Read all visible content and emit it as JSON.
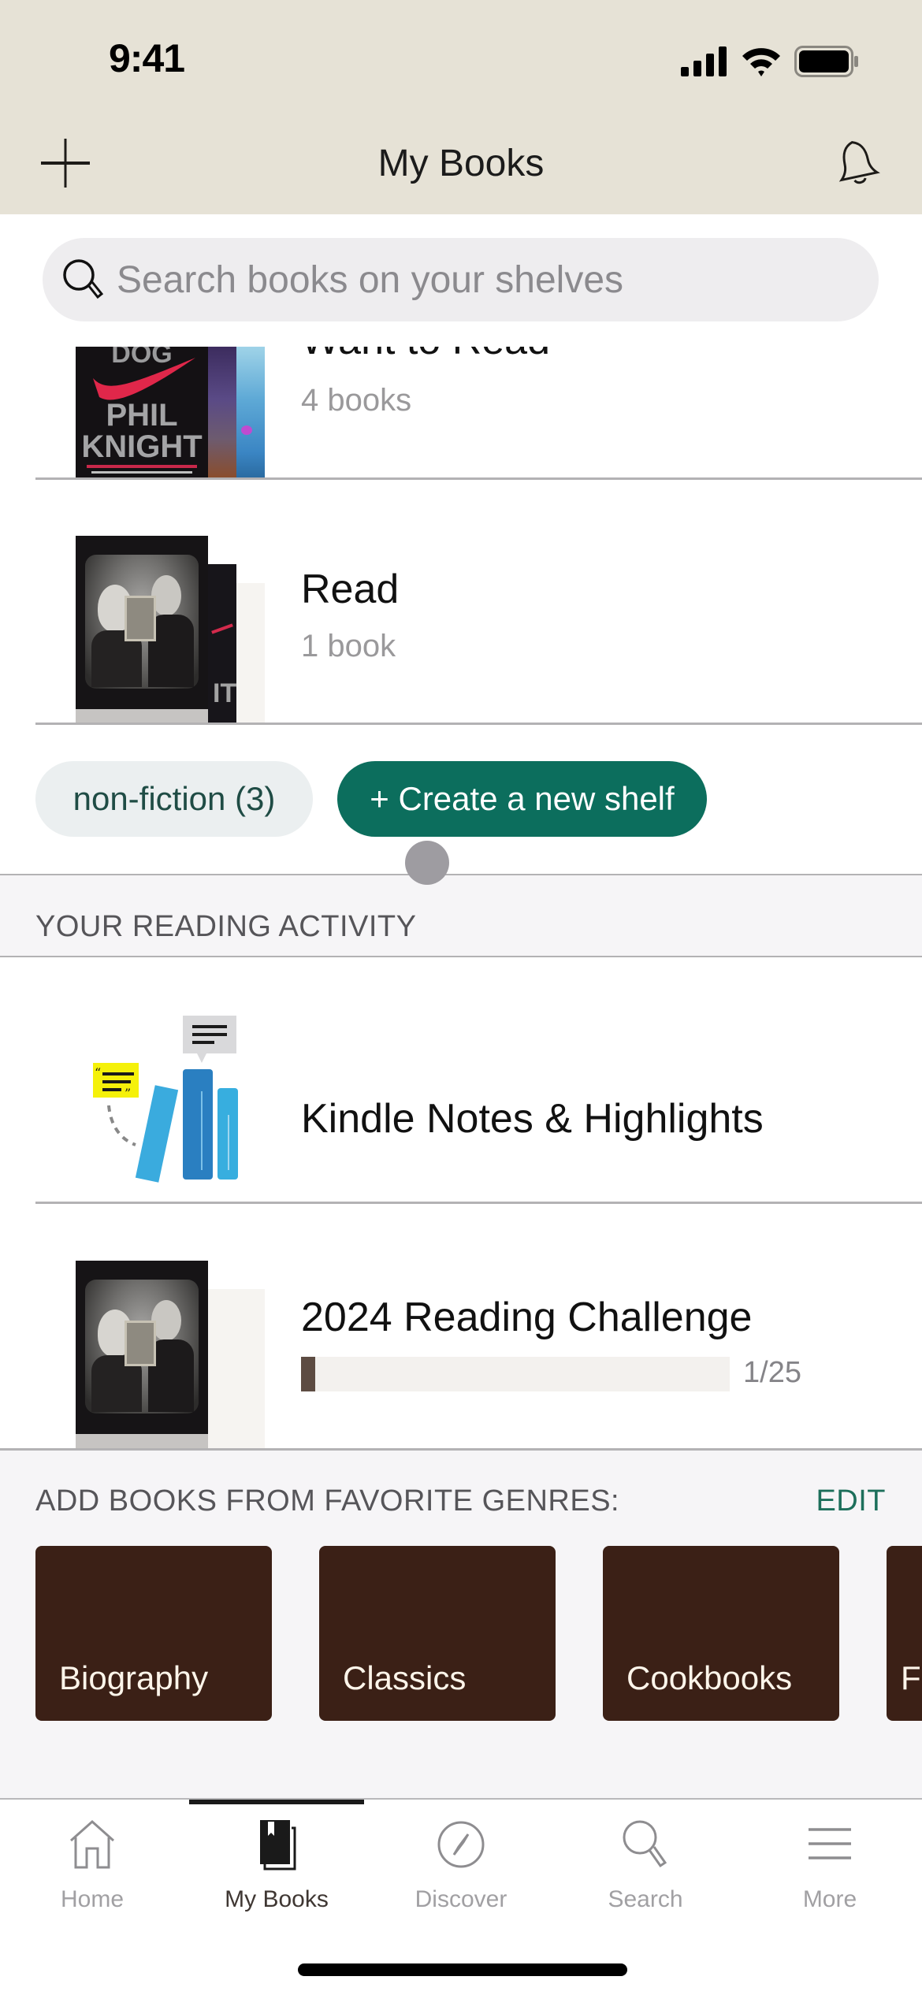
{
  "status_bar": {
    "time": "9:41"
  },
  "header": {
    "title": "My Books",
    "add_icon": "plus-icon",
    "notifications_icon": "bell-icon"
  },
  "search": {
    "placeholder": "Search books on your shelves",
    "value": "",
    "icon": "search-icon"
  },
  "shelves": [
    {
      "title": "Want to Read",
      "count_label": "4 books"
    },
    {
      "title": "Read",
      "count_label": "1 book"
    }
  ],
  "shelf_chips": {
    "custom_shelf": "non-fiction (3)",
    "create_button": "+ Create a new shelf"
  },
  "reading_activity": {
    "section_title": "YOUR READING ACTIVITY",
    "kindle": {
      "title": "Kindle Notes & Highlights"
    },
    "challenge": {
      "title": "2024 Reading Challenge",
      "progress_text": "1/25",
      "books_read": 1,
      "goal": 25
    }
  },
  "genres": {
    "section_title": "ADD BOOKS FROM FAVORITE GENRES:",
    "edit_label": "EDIT",
    "items": [
      {
        "label": "Biography"
      },
      {
        "label": "Classics"
      },
      {
        "label": "Cookbooks"
      },
      {
        "label": "F"
      }
    ]
  },
  "tab_bar": {
    "active": "My Books",
    "tabs": [
      {
        "label": "Home",
        "icon": "home-icon"
      },
      {
        "label": "My Books",
        "icon": "my-books-icon"
      },
      {
        "label": "Discover",
        "icon": "compass-icon"
      },
      {
        "label": "Search",
        "icon": "search-icon"
      },
      {
        "label": "More",
        "icon": "menu-icon"
      }
    ]
  },
  "colors": {
    "header_bg": "#E6E2D6",
    "accent_green": "#0C6E5D",
    "genre_card": "#3B2016",
    "progress_fill": "#5D4C43"
  }
}
